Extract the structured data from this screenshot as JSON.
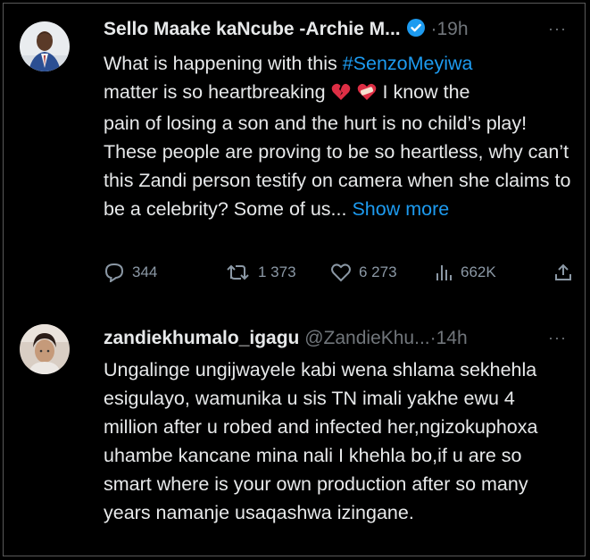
{
  "tweet1": {
    "name": "Sello Maake kaNcube -Archie M...",
    "separator": "·",
    "time": "19h",
    "more_label": "···",
    "text_before_hashtag": "What is happening with this ",
    "hashtag": "#SenzoMeyiwa",
    "text_line2_start": "matter is so heartbreaking ",
    "text_after_emojis": " I know the",
    "text_rest": "pain of losing a son and the hurt is no child’s play! These people are proving to be so heartless, why can’t this Zandi person testify on camera when she claims to be a celebrity? Some of us... ",
    "show_more": "Show more",
    "replies": "344",
    "retweets": "1 373",
    "likes": "6 273",
    "views": "662K",
    "colors": {
      "link": "#1d9bf0",
      "verified": "#1d9bf0"
    },
    "icons": [
      "reply-icon",
      "retweet-icon",
      "like-icon",
      "views-icon",
      "share-icon"
    ]
  },
  "tweet2": {
    "name": "zandiekhumalo_igagu",
    "handle": "@ZandieKhu...",
    "separator": "·",
    "time": "14h",
    "more_label": "···",
    "text": "Ungalinge ungijwayele kabi wena shlama sekhehla esigulayo, wamunika u sis TN imali yakhe ewu 4 million after u robed and infected her,ngizokuphoxa uhambe kancane mina nali I khehla bo,if u are so smart where is your own production after so many years namanje usaqashwa izingane."
  }
}
